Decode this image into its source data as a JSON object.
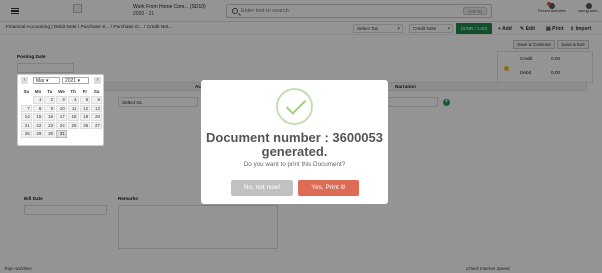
{
  "topbar": {
    "company_line1": "Work From Home Com... (SD10)",
    "company_line2": "2020 - 21",
    "search_placeholder": "Enter text to search",
    "search_shortcut": "(Alt+S)",
    "recent_label": "Recent Activities",
    "user_label": "sasi.jg.adm..."
  },
  "breadcrumb": "Financial Accounting  | Debit Note / Purchase S... / Purchase G... / Credit Not...",
  "toolbar": {
    "select_tax": "Select Tax",
    "voucher_type": "Credit Note",
    "currency": "(SINR / 1.00)",
    "add": "Add",
    "edit": "Edit",
    "print": "Print",
    "import": "Import"
  },
  "form": {
    "save_continue": "Save & Continue",
    "save_exit": "Save & Exit",
    "posting_date_label": "Posting Date",
    "credit_label": "Credit",
    "credit_value": "0.00",
    "debit_label": "Debit",
    "debit_value": "0.00",
    "account_header": "Ac",
    "narration_header": "Narration",
    "select_gl": "Select GL",
    "bill_date_label": "Bill Date",
    "remarks_label": "Remarks"
  },
  "datepicker": {
    "month": "Mar",
    "year": "2021",
    "weekdays": [
      "Su",
      "Mo",
      "Tu",
      "We",
      "Th",
      "Fr",
      "Sa"
    ],
    "weeks": [
      [
        "",
        "1",
        "2",
        "3",
        "4",
        "5",
        "6"
      ],
      [
        "7",
        "8",
        "9",
        "10",
        "11",
        "12",
        "13"
      ],
      [
        "14",
        "15",
        "16",
        "17",
        "18",
        "19",
        "20"
      ],
      [
        "21",
        "22",
        "23",
        "24",
        "25",
        "26",
        "27"
      ],
      [
        "28",
        "29",
        "30",
        "31",
        "",
        "",
        ""
      ]
    ],
    "selected_day": "31"
  },
  "modal": {
    "title": "Document number : 3600053 generated.",
    "subtitle": "Do you want to print this Document?",
    "no_button": "No, not now!",
    "yes_button": "Yes, Print it!"
  },
  "footer": {
    "left": "Trap Activities",
    "right": "Check Internet Speed"
  }
}
